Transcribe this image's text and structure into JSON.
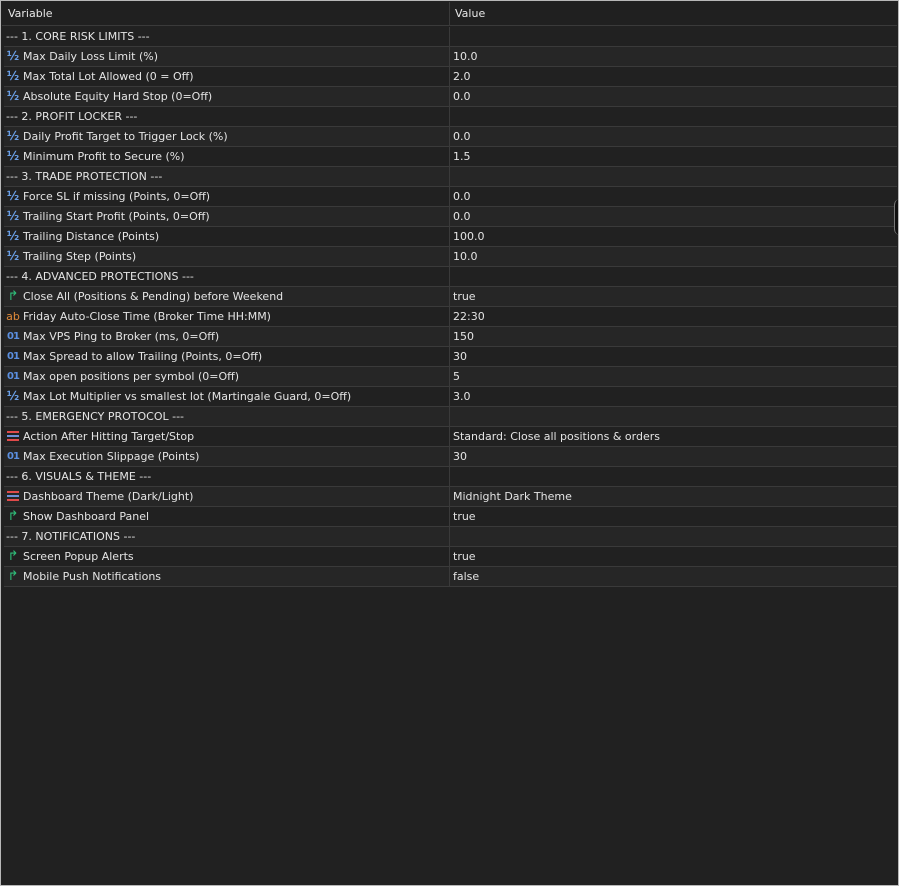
{
  "header": {
    "variable": "Variable",
    "value": "Value"
  },
  "rows": [
    {
      "type": "section",
      "label": "--- 1. CORE RISK LIMITS ---",
      "value": ""
    },
    {
      "type": "param",
      "icon": "half",
      "label": "Max Daily Loss Limit (%)",
      "value": "10.0"
    },
    {
      "type": "param",
      "icon": "half",
      "label": "Max Total Lot Allowed (0 = Off)",
      "value": "2.0"
    },
    {
      "type": "param",
      "icon": "half",
      "label": "Absolute Equity Hard Stop (0=Off)",
      "value": "0.0"
    },
    {
      "type": "section",
      "label": "--- 2. PROFIT LOCKER ---",
      "value": ""
    },
    {
      "type": "param",
      "icon": "half",
      "label": "Daily Profit Target to Trigger Lock (%)",
      "value": "0.0"
    },
    {
      "type": "param",
      "icon": "half",
      "label": "Minimum Profit to Secure (%)",
      "value": "1.5"
    },
    {
      "type": "section",
      "label": "--- 3. TRADE PROTECTION ---",
      "value": ""
    },
    {
      "type": "param",
      "icon": "half",
      "label": "Force SL if missing (Points, 0=Off)",
      "value": "0.0"
    },
    {
      "type": "param",
      "icon": "half",
      "label": "Trailing Start Profit (Points, 0=Off)",
      "value": "0.0"
    },
    {
      "type": "param",
      "icon": "half",
      "label": "Trailing Distance (Points)",
      "value": "100.0"
    },
    {
      "type": "param",
      "icon": "half",
      "label": "Trailing Step (Points)",
      "value": "10.0"
    },
    {
      "type": "section",
      "label": "--- 4. ADVANCED PROTECTIONS ---",
      "value": ""
    },
    {
      "type": "param",
      "icon": "flag",
      "label": "Close All (Positions & Pending) before Weekend",
      "value": "true"
    },
    {
      "type": "param",
      "icon": "str",
      "label": "Friday Auto-Close Time (Broker Time HH:MM)",
      "value": "22:30"
    },
    {
      "type": "param",
      "icon": "int",
      "label": "Max VPS Ping to Broker (ms, 0=Off)",
      "value": "150"
    },
    {
      "type": "param",
      "icon": "int",
      "label": "Max Spread to allow Trailing (Points, 0=Off)",
      "value": "30"
    },
    {
      "type": "param",
      "icon": "int",
      "label": "Max open positions per symbol (0=Off)",
      "value": "5"
    },
    {
      "type": "param",
      "icon": "half",
      "label": "Max Lot Multiplier vs smallest lot (Martingale Guard, 0=Off)",
      "value": "3.0"
    },
    {
      "type": "section",
      "label": "--- 5. EMERGENCY PROTOCOL ---",
      "value": ""
    },
    {
      "type": "param",
      "icon": "enum",
      "label": "Action After Hitting Target/Stop",
      "value": "Standard: Close all positions & orders"
    },
    {
      "type": "param",
      "icon": "int",
      "label": "Max Execution Slippage (Points)",
      "value": "30"
    },
    {
      "type": "section",
      "label": "--- 6. VISUALS & THEME ---",
      "value": ""
    },
    {
      "type": "param",
      "icon": "enum",
      "label": "Dashboard Theme (Dark/Light)",
      "value": "Midnight Dark Theme"
    },
    {
      "type": "param",
      "icon": "flag",
      "label": "Show Dashboard Panel",
      "value": "true"
    },
    {
      "type": "section",
      "label": "--- 7. NOTIFICATIONS ---",
      "value": ""
    },
    {
      "type": "param",
      "icon": "flag",
      "label": "Screen Popup Alerts",
      "value": "true"
    },
    {
      "type": "param",
      "icon": "flag",
      "label": "Mobile Push Notifications",
      "value": "false"
    }
  ],
  "icons": {
    "half": {
      "glyph": "½",
      "name": "double-type-icon"
    },
    "flag": {
      "glyph": "↱",
      "name": "bool-type-icon"
    },
    "str": {
      "glyph": "ab",
      "name": "string-type-icon"
    },
    "int": {
      "glyph": "01",
      "name": "integer-type-icon"
    },
    "enum": {
      "glyph": "",
      "name": "enum-type-icon"
    }
  },
  "colors": {
    "background": "#212121",
    "row_alt": "#262626",
    "grid": "#3a3a3a",
    "text": "#e4e4e4"
  }
}
